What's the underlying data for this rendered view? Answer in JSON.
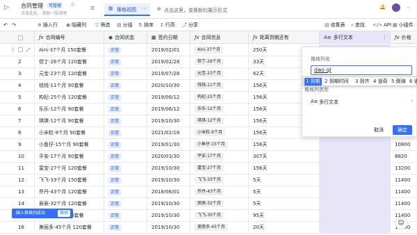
{
  "app": {
    "title": "合同管理",
    "badge": "可管理",
    "subtitle": "点击此处，添加一段说明"
  },
  "tabs": {
    "active": "推格视图",
    "add_view": "点击这里，变换新的展示形式"
  },
  "toolbar": {
    "insert_row": "插入行",
    "hide_col": "隐藏列",
    "filter": "筛选",
    "group": "分组",
    "sort": "排序",
    "row_height": "行高",
    "share": "分享",
    "collect": "收集表",
    "search": "查找",
    "api": "API",
    "widgets": "小组件"
  },
  "columns": {
    "c1": "合同编号",
    "c2": "合同状态",
    "c3": "签约日期",
    "c4": "合同信息",
    "c5": "距离到期还有",
    "c6": "多行文本",
    "c7": "价格"
  },
  "rows": [
    {
      "n": "1",
      "id": "Aini-37个月 150套餐",
      "st": "正常",
      "date": "2019/02/01",
      "info": "Aini-37个月",
      "days": "250天",
      "price": ""
    },
    {
      "n": "2",
      "id": "但丁-26个月 120套餐",
      "st": "正常",
      "date": "2019/02/28",
      "info": "但丁-26个月",
      "days": "33天",
      "price": ""
    },
    {
      "n": "3",
      "id": "元宝-23个月 120套餐",
      "st": "正常",
      "date": "2019/07/28",
      "info": "元宝-23个月",
      "days": "62天",
      "price": ""
    },
    {
      "n": "4",
      "id": "钱钱-11个月 90套餐",
      "st": "正常",
      "date": "2020/10/30",
      "info": "钱钱-11个月",
      "days": "156天",
      "price": ""
    },
    {
      "n": "5",
      "id": "构杞-25个月 120套餐",
      "st": "正常",
      "date": "2019/06/12",
      "info": "构杞-25个月",
      "days": "156天",
      "price": ""
    },
    {
      "n": "6",
      "id": "乐乐-12个月 90套餐",
      "st": "正常",
      "date": "2019/06/12",
      "info": "乐乐-12个月",
      "days": "156天",
      "price": ""
    },
    {
      "n": "7",
      "id": "琪琪-12个月 90套餐",
      "st": "正常",
      "date": "2019/10/30",
      "info": "琪琪-12个月",
      "days": "156天",
      "price": ""
    },
    {
      "n": "8",
      "id": "小米粒-9个月 90套餐",
      "st": "正常",
      "date": "2021/02/18",
      "info": "小米粒-9个月",
      "days": "156天",
      "price": ""
    },
    {
      "n": "9",
      "id": "小鱼仔-15个月 90套餐",
      "st": "正常",
      "date": "2019/01/30",
      "info": "小鱼仔-15个月",
      "days": "156天",
      "price": "10800"
    },
    {
      "n": "10",
      "id": "平安-17个月 90套餐",
      "st": "正常",
      "date": "2020/03/30",
      "info": "平安-17个月",
      "days": "307天",
      "price": "8820"
    },
    {
      "n": "11",
      "id": "富宝-27个月 120套餐",
      "st": "正常",
      "date": "2019/10/30",
      "info": "富宝-27个月",
      "days": "156天",
      "price": "13200"
    },
    {
      "n": "12",
      "id": "飞飞-33个月 150套餐",
      "st": "正常",
      "date": "2019/10/30",
      "info": "飞飞-33个月",
      "days": "5天",
      "price": "11400"
    },
    {
      "n": "13",
      "id": "乔丹-43个月 120套餐",
      "st": "正常",
      "date": "2018/06/01",
      "info": "乔丹-43个月",
      "days": "5天",
      "price": "11400"
    },
    {
      "n": "14",
      "id": "辰辰-32个月 120套餐",
      "st": "正常",
      "date": "2019/10/30",
      "info": "辰辰-32个月",
      "days": "5天",
      "price": "11400"
    },
    {
      "n": "15",
      "id": "飞飞-30个月 90套餐",
      "st": "正常",
      "date": "2019/10/30",
      "info": "飞飞-30个月",
      "days": "95天",
      "price": "11400"
    },
    {
      "n": "16",
      "id": "美丽多-45个月 120套餐",
      "st": "正常",
      "date": "2019/10/30",
      "info": "美丽多-45个月",
      "days": "20天",
      "price": "11400"
    }
  ],
  "panel": {
    "name_label": "推格列名",
    "name_value": "dao qi",
    "type_label": "推格列类型",
    "type_value": "多行文本",
    "cancel": "取消",
    "confirm": "确定"
  },
  "ime": {
    "candidates": [
      "1 到期",
      "2 到期时间",
      "3 到齐",
      "4 道奇",
      "5 倒骑",
      "6 道"
    ]
  },
  "toast": {
    "text": "插入推格列成功",
    "undo": "撤销"
  }
}
